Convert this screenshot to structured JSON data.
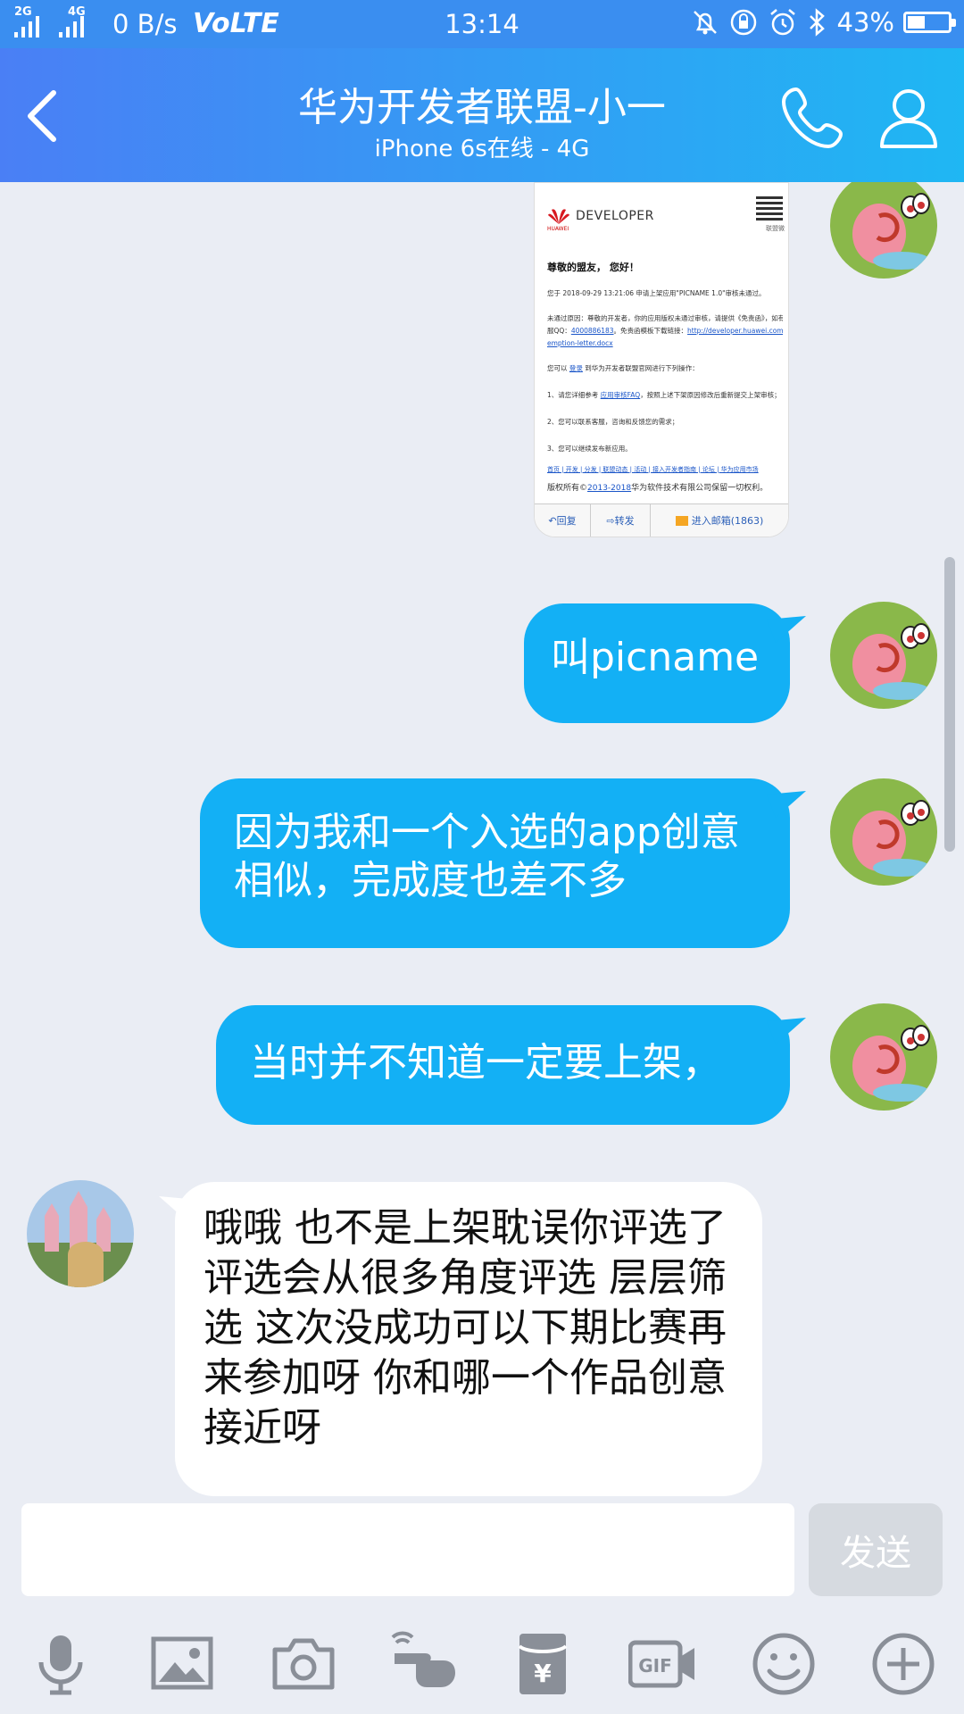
{
  "status_bar": {
    "net_label_1": "2G",
    "net_label_2": "4G",
    "speed": "0 B/s",
    "volte": "VoLTE",
    "time": "13:14",
    "battery_percent": "43%",
    "battery_level": 0.43
  },
  "header": {
    "title": "华为开发者联盟-小一",
    "subtitle": "iPhone 6s在线 - 4G"
  },
  "email_card": {
    "brand": "DEVELOPER",
    "brand_small": "HUAWEI",
    "qr_label": "联盟微",
    "greeting": "尊敬的盟友， 您好！",
    "line1": "您于 2018-09-29 13:21:06 申请上架应用\"PICNAME 1.0\"审核未通过。",
    "line2": "未通过原因：尊敬的开发者，你的应用版权未通过审核，请提供《免责函》，如有疑",
    "line3a": "服QQ：",
    "line3_link1": "4000886183",
    "line3b": "。免责函模板下载链接：",
    "line3_link2": "http://developer.huawei.com/devunion",
    "line4_link": "emption-letter.docx",
    "line5a": "您可以 ",
    "line5_link": "登录",
    "line5b": " 到华为开发者联盟官网进行下列操作：",
    "line6a": "1、请您详细参考 ",
    "line6_link": "应用审核FAQ",
    "line6b": "，按照上述下架原因修改后重新提交上架审核；",
    "line7": "2、您可以联系客服，咨询和反馈您的需求；",
    "line8": "3、您可以继续发布新应用。",
    "nav_links": "首页  |  开发  |  分发  |  联盟动态  |  活动  |  接入开发者指南  |  论坛  |  华为应用市场",
    "copyright_a": "版权所有©",
    "copyright_link": "2013-2018",
    "copyright_b": "华为软件技术有限公司保留一切权利。",
    "reply": "回复",
    "forward": "转发",
    "inbox": "进入邮箱(1863)"
  },
  "messages": [
    {
      "from": "me",
      "text": "叫picname"
    },
    {
      "from": "me",
      "text": "因为我和一个入选的app创意相似，完成度也差不多"
    },
    {
      "from": "me",
      "text": "当时并不知道一定要上架，"
    },
    {
      "from": "other",
      "text": "哦哦 也不是上架耽误你评选了 评选会从很多角度评选 层层筛选 这次没成功可以下期比赛再来参加呀 你和哪一个作品创意接近呀"
    }
  ],
  "input": {
    "value": "",
    "send_label": "发送"
  },
  "toolbar": [
    "microphone-icon",
    "image-icon",
    "camera-icon",
    "poke-icon",
    "red-packet-icon",
    "gif-icon",
    "emoji-icon",
    "plus-icon"
  ],
  "colors": {
    "header_gradient_start": "#4a7ff5",
    "header_gradient_end": "#1fb7f3",
    "bubble_out": "#13b0f5",
    "bubble_in": "#ffffff",
    "background": "#eaedf4"
  }
}
